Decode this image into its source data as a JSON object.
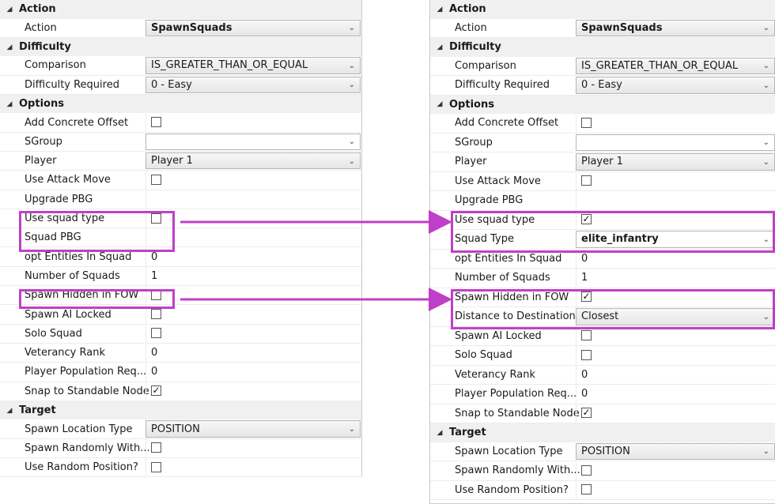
{
  "colors": {
    "highlight": "#c03fc8",
    "header_bg": "#f0f0f0"
  },
  "left_panel": {
    "sections": [
      {
        "title": "Action",
        "rows": [
          {
            "label": "Action",
            "type": "dropdown",
            "value": "SpawnSquads",
            "bold": true
          }
        ]
      },
      {
        "title": "Difficulty",
        "rows": [
          {
            "label": "Comparison",
            "type": "dropdown",
            "value": "IS_GREATER_THAN_OR_EQUAL"
          },
          {
            "label": "Difficulty Required",
            "type": "dropdown",
            "value": "0 - Easy"
          }
        ]
      },
      {
        "title": "Options",
        "rows": [
          {
            "label": "Add Concrete Offset",
            "type": "checkbox",
            "checked": false
          },
          {
            "label": "SGroup",
            "type": "dropdown",
            "value": "",
            "white": true
          },
          {
            "label": "Player",
            "type": "dropdown",
            "value": "Player 1"
          },
          {
            "label": "Use Attack Move",
            "type": "checkbox",
            "checked": false
          },
          {
            "label": "Upgrade PBG",
            "type": "text",
            "value": ""
          },
          {
            "label": "Use squad type",
            "type": "checkbox",
            "checked": false
          },
          {
            "label": "Squad PBG",
            "type": "text",
            "value": ""
          },
          {
            "label": "opt Entities In Squad",
            "type": "text",
            "value": "0"
          },
          {
            "label": "Number of Squads",
            "type": "text",
            "value": "1"
          },
          {
            "label": "Spawn Hidden in FOW",
            "type": "checkbox",
            "checked": false
          },
          {
            "label": "Spawn AI Locked",
            "type": "checkbox",
            "checked": false
          },
          {
            "label": "Solo Squad",
            "type": "checkbox",
            "checked": false
          },
          {
            "label": "Veterancy Rank",
            "type": "text",
            "value": "0"
          },
          {
            "label": "Player Population Req...",
            "type": "text",
            "value": "0"
          },
          {
            "label": "Snap to Standable Node",
            "type": "checkbox",
            "checked": true
          }
        ]
      },
      {
        "title": "Target",
        "rows": [
          {
            "label": "Spawn Location Type",
            "type": "dropdown",
            "value": "POSITION"
          },
          {
            "label": "Spawn Randomly With...",
            "type": "checkbox",
            "checked": false
          },
          {
            "label": "Use Random Position?",
            "type": "checkbox",
            "checked": false
          }
        ]
      }
    ]
  },
  "right_panel": {
    "sections": [
      {
        "title": "Action",
        "rows": [
          {
            "label": "Action",
            "type": "dropdown",
            "value": "SpawnSquads",
            "bold": true
          }
        ]
      },
      {
        "title": "Difficulty",
        "rows": [
          {
            "label": "Comparison",
            "type": "dropdown",
            "value": "IS_GREATER_THAN_OR_EQUAL"
          },
          {
            "label": "Difficulty Required",
            "type": "dropdown",
            "value": "0 - Easy"
          }
        ]
      },
      {
        "title": "Options",
        "rows": [
          {
            "label": "Add Concrete Offset",
            "type": "checkbox",
            "checked": false
          },
          {
            "label": "SGroup",
            "type": "dropdown",
            "value": "",
            "white": true
          },
          {
            "label": "Player",
            "type": "dropdown",
            "value": "Player 1"
          },
          {
            "label": "Use Attack Move",
            "type": "checkbox",
            "checked": false
          },
          {
            "label": "Upgrade PBG",
            "type": "text",
            "value": ""
          },
          {
            "label": "Use squad type",
            "type": "checkbox",
            "checked": true
          },
          {
            "label": "Squad Type",
            "type": "dropdown",
            "value": "elite_infantry",
            "bold": true,
            "white": true
          },
          {
            "label": "opt Entities In Squad",
            "type": "text",
            "value": "0"
          },
          {
            "label": "Number of Squads",
            "type": "text",
            "value": "1"
          },
          {
            "label": "Spawn Hidden in FOW",
            "type": "checkbox",
            "checked": true
          },
          {
            "label": "Distance to Destination",
            "type": "dropdown",
            "value": "Closest"
          },
          {
            "label": "Spawn AI Locked",
            "type": "checkbox",
            "checked": false
          },
          {
            "label": "Solo Squad",
            "type": "checkbox",
            "checked": false
          },
          {
            "label": "Veterancy Rank",
            "type": "text",
            "value": "0"
          },
          {
            "label": "Player Population Req...",
            "type": "text",
            "value": "0"
          },
          {
            "label": "Snap to Standable Node",
            "type": "checkbox",
            "checked": true
          }
        ]
      },
      {
        "title": "Target",
        "rows": [
          {
            "label": "Spawn Location Type",
            "type": "dropdown",
            "value": "POSITION"
          },
          {
            "label": "Spawn Randomly With...",
            "type": "checkbox",
            "checked": false
          },
          {
            "label": "Use Random Position?",
            "type": "checkbox",
            "checked": false
          }
        ]
      }
    ]
  },
  "icons": {
    "expanded": "collapse-caret-icon",
    "dropdown": "chevron-down-icon",
    "check": "checkmark-icon"
  }
}
